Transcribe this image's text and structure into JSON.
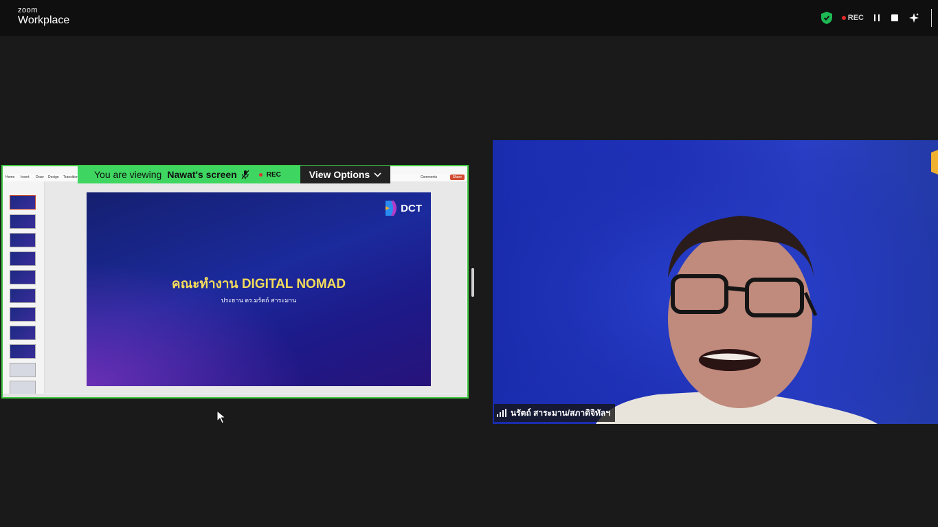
{
  "app": {
    "logo_small": "zoom",
    "logo_big": "Workplace"
  },
  "top_controls": {
    "rec_label": "REC"
  },
  "share": {
    "viewing_prefix": "You are viewing",
    "viewing_name": "Nawat's screen",
    "rec_label": "REC",
    "view_options_label": "View Options"
  },
  "ppt": {
    "tabs": [
      "Home",
      "Insert",
      "Draw",
      "Design",
      "Transitions"
    ],
    "share_label": "Share",
    "comments_label": "Comments"
  },
  "slide": {
    "logo_text": "DCT",
    "title": "คณะทำงาน DIGITAL NOMAD",
    "subtitle": "ประธาน ดร.มรัตถ์ สาระมาน"
  },
  "participant": {
    "name": "นรัตถ์ สาระมาน/สภาดิจิทัลฯ"
  },
  "colors": {
    "share_border": "#3fc73f",
    "banner_green": "#3ed660",
    "rec_red": "#e02828",
    "shield_green": "#1db954",
    "slide_title": "#f4dc5a"
  },
  "icons": [
    "shield-check-icon",
    "rec-dot-icon",
    "pause-icon",
    "stop-icon",
    "ai-sparkle-icon",
    "mic-muted-icon",
    "chevron-down-icon",
    "signal-bars-icon",
    "mouse-cursor-icon"
  ]
}
